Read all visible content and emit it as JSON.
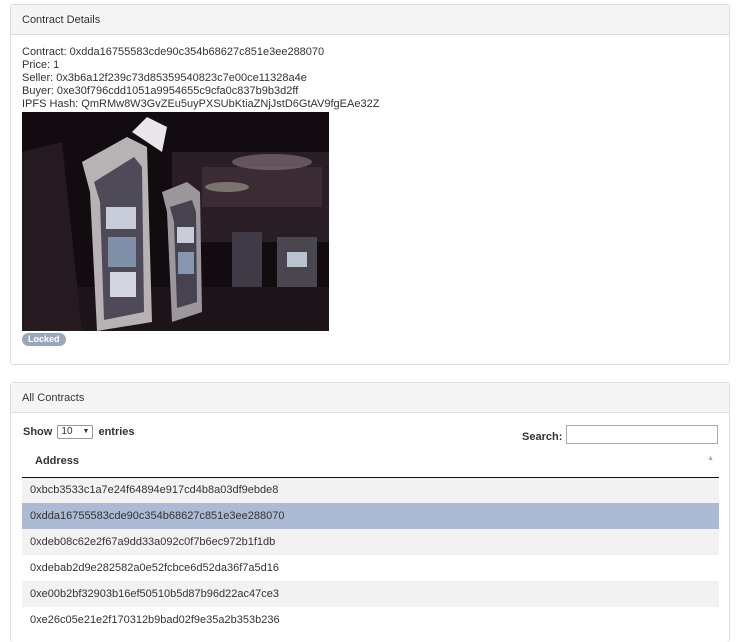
{
  "details": {
    "heading": "Contract Details",
    "contract": "Contract: 0xdda16755583cde90c354b68627c851e3ee288070",
    "price": "Price: 1",
    "seller": "Seller: 0x3b6a12f239c73d85359540823c7e00ce11328a4e",
    "buyer": "Buyer: 0xe30f796cdd1051a9954655c9cfa0c837b9b3d2ff",
    "ipfs": "IPFS Hash: QmRMw8W3GvZEu5uyPXSUbKtiaZNjJstD6GtAV9fgEAe32Z",
    "status": "Locked"
  },
  "contracts": {
    "heading": "All Contracts",
    "show_label": "Show",
    "entries_value": "10",
    "entries_label": "entries",
    "search_label": "Search:",
    "search_value": "",
    "column_header": "Address",
    "rows": [
      "0xbcb3533c1a7e24f64894e917cd4b8a03df9ebde8",
      "0xdda16755583cde90c354b68627c851e3ee288070",
      "0xdeb08c62e2f67a9dd33a092c0f7b6ec972b1f1db",
      "0xdebab2d9e282582a0e52fcbce6d52da36f7a5d16",
      "0xe00b2bf32903b16ef50510b5d87b96d22ac47ce3",
      "0xe26c05e21e2f170312b9bad02f9e35a2b353b236"
    ],
    "selected_row": "0xdda16755583cde90c354b68627c851e3ee288070"
  }
}
